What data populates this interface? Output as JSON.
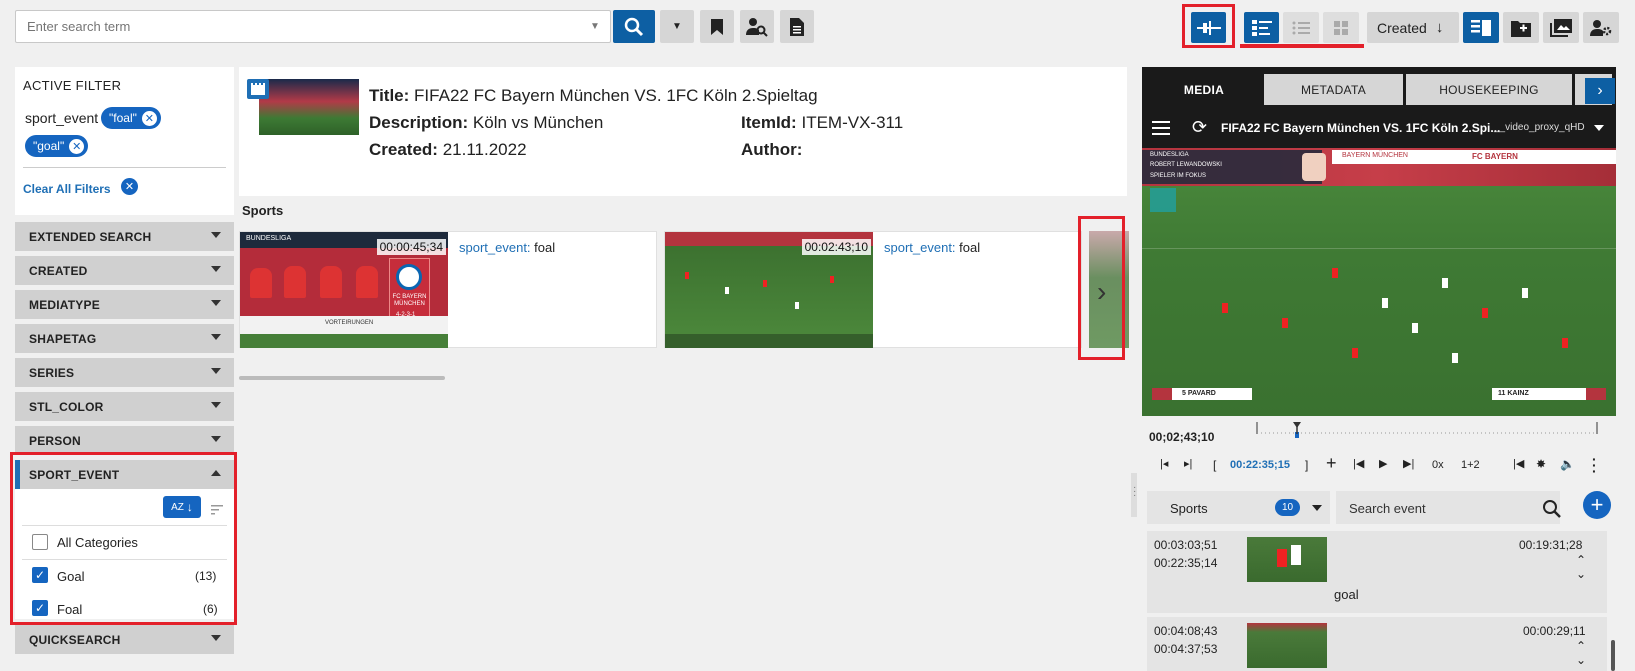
{
  "toolbar": {
    "search_placeholder": "Enter search term",
    "sort_label": "Created"
  },
  "active_filter": {
    "title": "ACTIVE FILTER",
    "field": "sport_event",
    "chips": [
      "\"foal\"",
      "\"goal\""
    ],
    "clear_label": "Clear All Filters"
  },
  "facets": [
    "EXTENDED SEARCH",
    "CREATED",
    "MEDIATYPE",
    "SHAPETAG",
    "SERIES",
    "STL_COLOR",
    "PERSON",
    "SPORT_EVENT",
    "QUICKSEARCH"
  ],
  "sport_event_facet": {
    "sort_button": "AZ",
    "all_categories": "All Categories",
    "options": [
      {
        "label": "Goal",
        "count": "(13)",
        "checked": true
      },
      {
        "label": "Foal",
        "count": "(6)",
        "checked": true
      }
    ]
  },
  "item": {
    "title_label": "Title:",
    "title": "FIFA22 FC Bayern München VS. 1FC Köln 2.Spieltag",
    "description_label": "Description:",
    "description": "Köln vs München",
    "created_label": "Created:",
    "created": "21.11.2022",
    "itemid_label": "ItemId:",
    "itemid": "ITEM-VX-311",
    "author_label": "Author:",
    "author": ""
  },
  "sports_section": {
    "title": "Sports",
    "clips": [
      {
        "timecode": "00:00:45;34",
        "key": "sport_event:",
        "value": "foal"
      },
      {
        "timecode": "00:02:43;10",
        "key": "sport_event:",
        "value": "foal"
      }
    ]
  },
  "right_panel": {
    "tabs": [
      "MEDIA",
      "METADATA",
      "HOUSEKEEPING"
    ],
    "player_title": "FIFA22 FC Bayern München VS. 1FC Köln 2.Spi...",
    "proxy": "__video_proxy_qHD",
    "current_time": "00;02;43;10",
    "in_point": "00:22:35;15",
    "speed": "0x",
    "channels": "1+2",
    "event_group": "Sports",
    "event_count": "10",
    "search_event_placeholder": "Search event",
    "events": [
      {
        "start": "00:03:03;51",
        "end": "00:22:35;14",
        "duration": "00:19:31;28",
        "label": "goal"
      },
      {
        "start": "00:04:08;43",
        "end": "00:04:37;53",
        "duration": "00:00:29;11",
        "label": ""
      }
    ],
    "video_overlay": {
      "left_player": "5 PAVARD",
      "right_player": "11 KAINZ",
      "league": "BUNDESLIGA",
      "spotlight": "SPIELER IM FOKUS",
      "scorer": "ROBERT LEWANDOWSKI",
      "team_banner": "FC BAYERN",
      "team_banner_short": "BAYERN MÜNCHEN"
    },
    "clip_overlay": {
      "league": "BUNDESLIGA",
      "team": "FC BAYERN MÜNCHEN",
      "formation": "4-2-3-1",
      "lineup": "VORTEIRUNGEN"
    }
  },
  "colors": {
    "accent": "#0d5fa3",
    "highlight": "#e3202a",
    "pitch": "#3f7a34"
  }
}
